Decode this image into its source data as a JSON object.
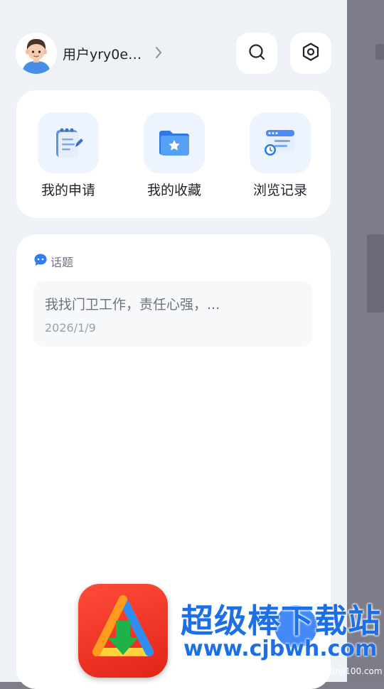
{
  "user": {
    "name": "用户yry0e…",
    "avatar_icon": "user-avatar-icon"
  },
  "header": {
    "search_icon": "search-icon",
    "settings_icon": "settings-icon"
  },
  "quick_actions": [
    {
      "label": "我的申请",
      "icon": "notepad-icon"
    },
    {
      "label": "我的收藏",
      "icon": "star-folder-icon"
    },
    {
      "label": "浏览记录",
      "icon": "browser-history-icon"
    }
  ],
  "topics": {
    "title": "话题",
    "posts": [
      {
        "text": "我找门卫工作，责任心强，...",
        "date": "2026/1/9"
      }
    ]
  },
  "watermark": {
    "title": "超级棒下载站",
    "url": "www.cjbwh.com",
    "sub": "danji100.com"
  },
  "colors": {
    "accent": "#2f7cf6",
    "background": "#eef1f5",
    "card": "#ffffff"
  }
}
